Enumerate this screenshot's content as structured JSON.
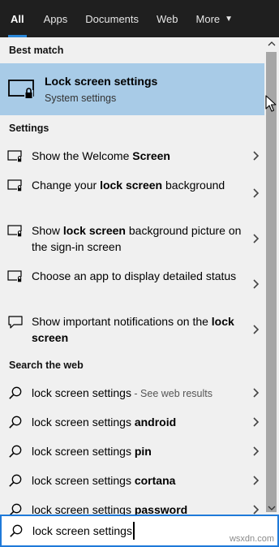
{
  "tabs": [
    {
      "label": "All",
      "active": true
    },
    {
      "label": "Apps"
    },
    {
      "label": "Documents"
    },
    {
      "label": "Web"
    },
    {
      "label": "More"
    }
  ],
  "best_match": {
    "header": "Best match",
    "title": "Lock screen settings",
    "subtitle": "System settings",
    "icon": "lock-screen-icon"
  },
  "settings": {
    "header": "Settings",
    "items": [
      {
        "pre": "Show the Welcome ",
        "bold": "Screen",
        "post": "",
        "icon": "lock-screen-small-icon"
      },
      {
        "pre": "Change your ",
        "bold": "lock screen",
        "post": " background",
        "icon": "lock-screen-small-icon"
      },
      {
        "pre": "Show ",
        "bold": "lock screen",
        "post": " background picture on the sign-in screen",
        "icon": "lock-screen-small-icon"
      },
      {
        "pre": "Choose an app to display detailed status",
        "bold": "",
        "post": "",
        "icon": "lock-screen-small-icon"
      },
      {
        "pre": "Show important notifications on the ",
        "bold": "lock screen",
        "post": "",
        "icon": "notification-speech-icon"
      }
    ]
  },
  "web": {
    "header": "Search the web",
    "items": [
      {
        "text": "lock screen settings",
        "bold": "",
        "suffix": " - See web results"
      },
      {
        "text": "lock screen settings ",
        "bold": "android",
        "suffix": ""
      },
      {
        "text": "lock screen settings ",
        "bold": "pin",
        "suffix": ""
      },
      {
        "text": "lock screen settings ",
        "bold": "cortana",
        "suffix": ""
      },
      {
        "text": "lock screen settings ",
        "bold": "password",
        "suffix": ""
      }
    ]
  },
  "search": {
    "value": "lock screen settings"
  },
  "watermark": "wsxdn.com",
  "colors": {
    "tab_bar": "#1f1f1f",
    "accent": "#2b88d8",
    "best_match_bg": "#a8cbe7",
    "panel_bg": "#f0f0f0",
    "scroll_thumb": "#a6a6a6"
  }
}
